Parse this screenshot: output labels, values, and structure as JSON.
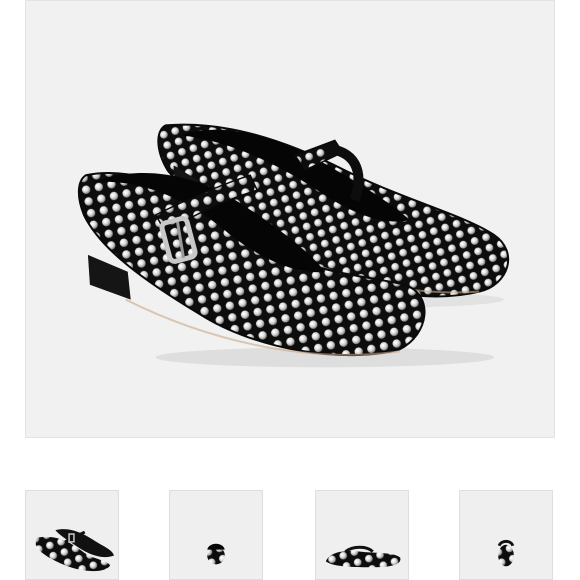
{
  "gallery": {
    "main_image": {
      "icon": "studded-mary-jane-flats-photo",
      "background": "#f1f1f1"
    },
    "thumbnails": [
      {
        "icon": "pair-angle-view",
        "selected": true
      },
      {
        "icon": "front-toe-view"
      },
      {
        "icon": "side-profile-view"
      },
      {
        "icon": "back-heel-view"
      }
    ]
  },
  "colors": {
    "shoe": "#0d0d0d",
    "stud": "#e8e8e8",
    "buckle": "#c8c8c8"
  }
}
